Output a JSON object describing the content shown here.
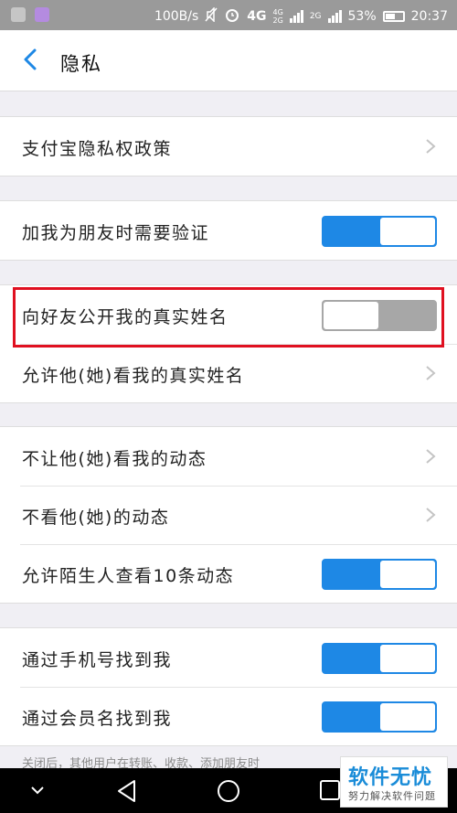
{
  "status_bar": {
    "speed": "100B/s",
    "network_primary": "4G",
    "network_secondary_top": "4G",
    "network_secondary_bottom": "2G",
    "network_tertiary": "2G",
    "battery": "53%",
    "time": "20:37"
  },
  "header": {
    "title": "隐私"
  },
  "rows": {
    "privacy_policy": "支付宝隐私权政策",
    "friend_verify": "加我为朋友时需要验证",
    "show_real_name": "向好友公开我的真实姓名",
    "allow_view_real_name": "允许他(她)看我的真实姓名",
    "hide_my_moments": "不让他(她)看我的动态",
    "hide_their_moments": "不看他(她)的动态",
    "stranger_ten": "允许陌生人查看10条动态",
    "find_by_phone": "通过手机号找到我",
    "find_by_member": "通过会员名找到我"
  },
  "toggles": {
    "friend_verify": true,
    "show_real_name": false,
    "stranger_ten": true,
    "find_by_phone": true,
    "find_by_member": true
  },
  "footnote": "关闭后，其他用户在转账、收款、添加朋友时",
  "watermark": {
    "line1": "软件无忧",
    "line2": "努力解决软件问题"
  },
  "colors": {
    "accent": "#1e88e5",
    "highlight": "#e01020",
    "toggle_off": "#a7a7a7"
  }
}
